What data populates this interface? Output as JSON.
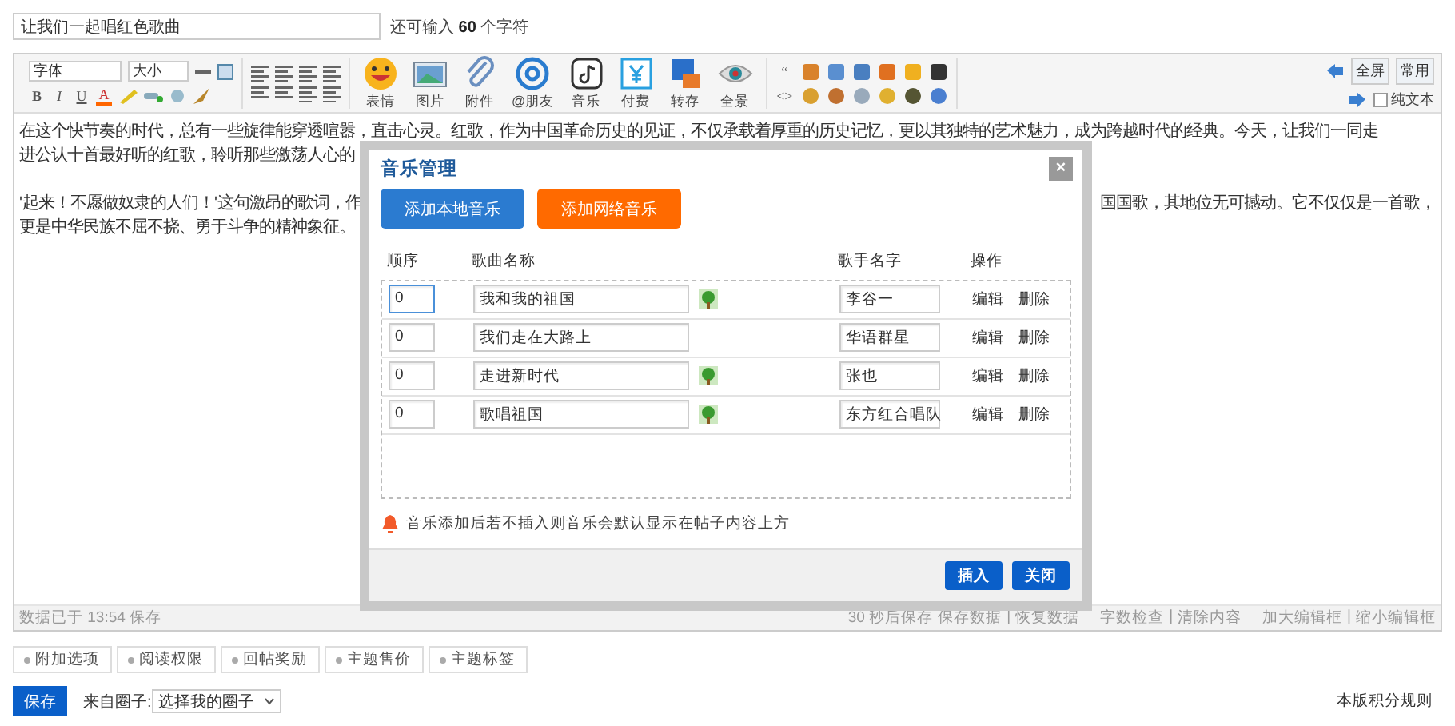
{
  "title_field": {
    "value": "让我们一起唱红色歌曲"
  },
  "title_hint": "还可输入 **60** 个字符",
  "toolbar": {
    "font_select": "字体",
    "size_select": "大小",
    "format_buttons": [
      "B",
      "I",
      "U",
      "A"
    ],
    "tools": [
      "表情",
      "图片",
      "附件",
      "@朋友",
      "音乐",
      "付费",
      "转存",
      "全景"
    ],
    "quote_glyph": "“",
    "code_glyph": "<>",
    "fullscreen": "全屏",
    "common": "常用",
    "plain_text": {
      "label": "纯文本",
      "checked": false
    }
  },
  "body": {
    "paragraphs": [
      {
        "lines": [
          {
            "left": "在这个快节奏的时代，总有一些旋律能穿透喧嚣，直击心灵。红歌，作为中国革命历史的见证，不仅承载着厚重的历史记忆，更以其独特的艺术魅力，成为跨越时代的经典。今天，让我们一同走"
          },
          {
            "left": "进公认十首最好听的红歌，聆听那些激荡人心的"
          }
        ]
      },
      {
        "lines": [
          {
            "left": "'起来！不愿做奴隶的人们！'这句激昂的歌词，作",
            "right": "国国歌，其地位无可撼动。它不仅仅是一首歌，"
          },
          {
            "left": "更是中华民族不屈不挠、勇于斗争的精神象征。"
          }
        ]
      }
    ]
  },
  "status_bar": {
    "saved": "数据已于 13:54 保存",
    "actions": [
      {
        "kind": "text",
        "label": "30 秒后保存"
      },
      {
        "kind": "link",
        "label": "保存数据"
      },
      {
        "kind": "sep",
        "label": "|"
      },
      {
        "kind": "link",
        "label": "恢复数据"
      },
      {
        "kind": "link",
        "label": "字数检查"
      },
      {
        "kind": "sep",
        "label": "|"
      },
      {
        "kind": "link",
        "label": "清除内容"
      },
      {
        "kind": "link",
        "label": "加大编辑框"
      },
      {
        "kind": "sep",
        "label": "|"
      },
      {
        "kind": "link",
        "label": "缩小编辑框"
      }
    ]
  },
  "option_tabs": [
    "附加选项",
    "阅读权限",
    "回帖奖励",
    "主题售价",
    "主题标签"
  ],
  "save_button": "保存",
  "circle": {
    "label": "来自圈子:",
    "value": "选择我的圈子"
  },
  "rules_link": "本版积分规则",
  "dialog": {
    "title": "音乐管理",
    "close": "×",
    "add_local": "添加本地音乐",
    "add_online": "添加网络音乐",
    "columns": [
      "顺序",
      "歌曲名称",
      "歌手名字",
      "操作"
    ],
    "rows": [
      {
        "order": "0",
        "song": "我和我的祖国",
        "has_cover": true,
        "singer": "李谷一",
        "focused": true,
        "edit": "编辑",
        "delete": "删除"
      },
      {
        "order": "0",
        "song": "我们走在大路上",
        "has_cover": false,
        "singer": "华语群星",
        "focused": false,
        "edit": "编辑",
        "delete": "删除"
      },
      {
        "order": "0",
        "song": "走进新时代",
        "has_cover": true,
        "singer": "张也",
        "focused": false,
        "edit": "编辑",
        "delete": "删除"
      },
      {
        "order": "0",
        "song": "歌唱祖国",
        "has_cover": true,
        "singer": "东方红合唱队",
        "focused": false,
        "edit": "编辑",
        "delete": "删除"
      }
    ],
    "note": "音乐添加后若不插入则音乐会默认显示在帖子内容上方",
    "insert": "插入",
    "close_button": "关闭"
  }
}
